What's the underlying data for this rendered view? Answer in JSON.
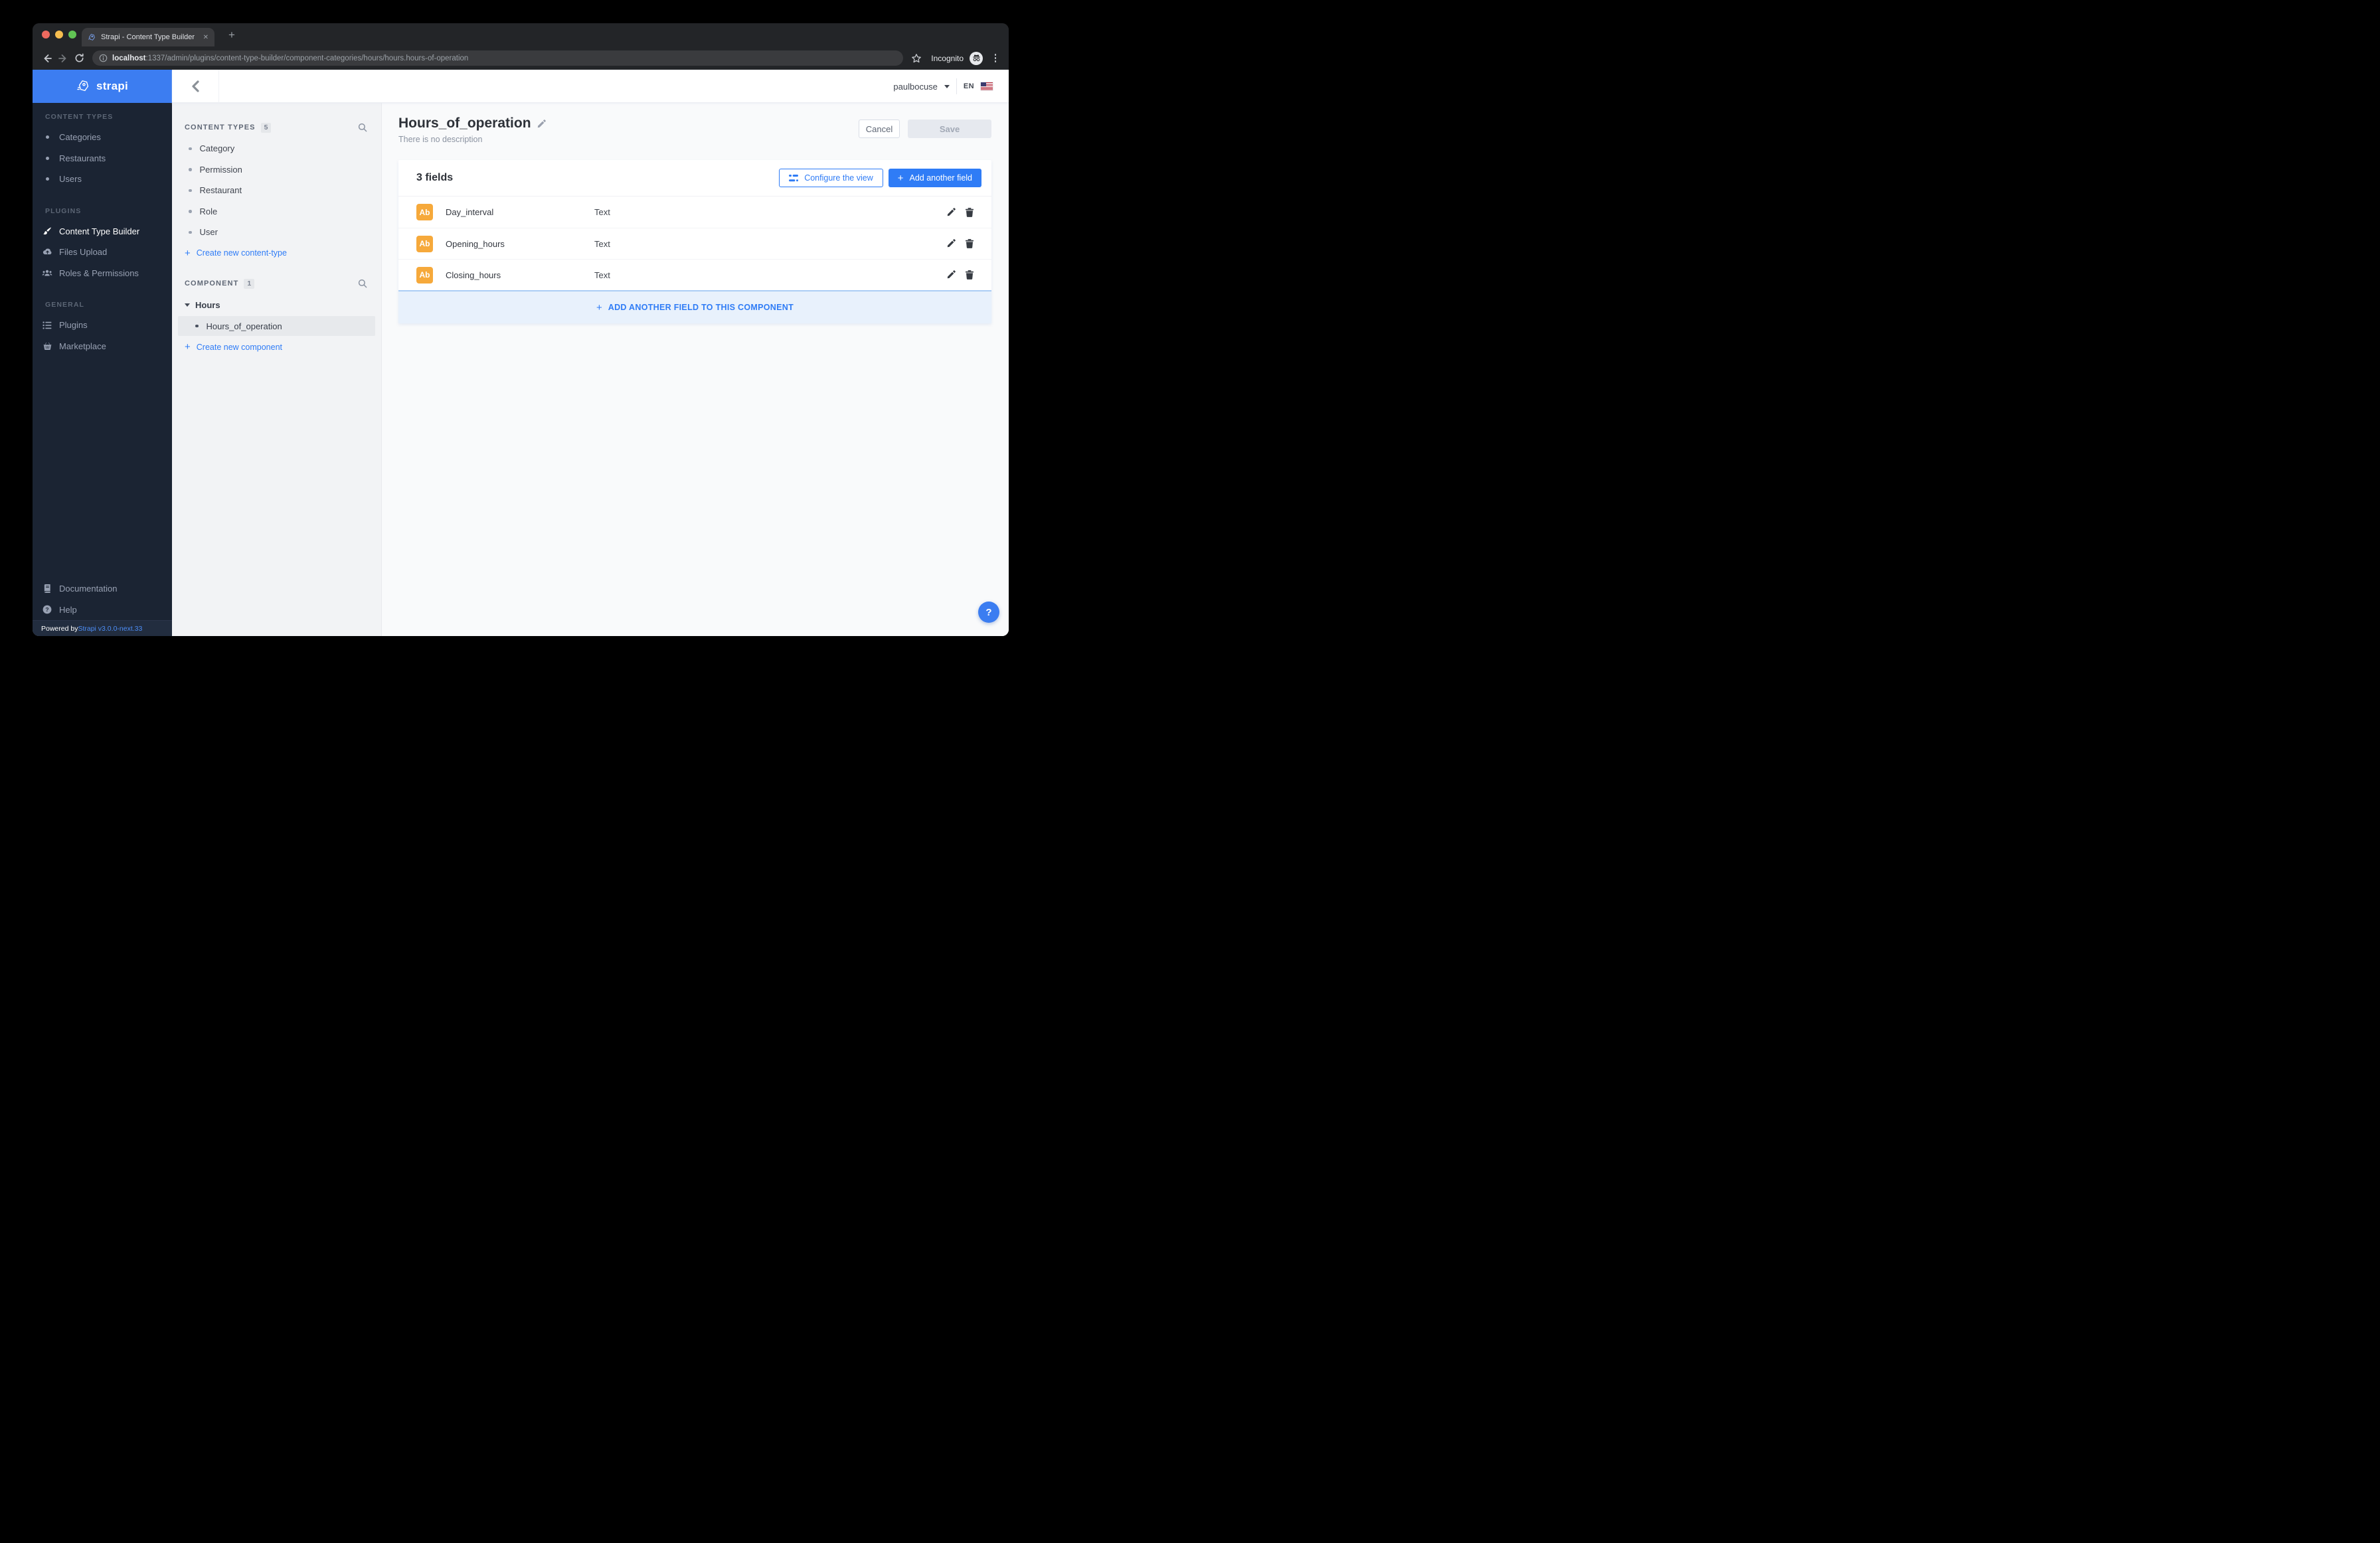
{
  "browser": {
    "tab_title": "Strapi - Content Type Builder",
    "close_tab": "✕",
    "new_tab": "+",
    "url_host": "localhost",
    "url_rest": ":1337/admin/plugins/content-type-builder/component-categories/hours/hours.hours-of-operation",
    "incognito_label": "Incognito"
  },
  "app_header": {
    "user": "paulbocuse",
    "locale": "EN"
  },
  "sidebar": {
    "brand": "strapi",
    "sections": [
      {
        "label": "CONTENT TYPES",
        "items": [
          {
            "label": "Categories"
          },
          {
            "label": "Restaurants"
          },
          {
            "label": "Users"
          }
        ]
      },
      {
        "label": "PLUGINS",
        "items": [
          {
            "label": "Content Type Builder"
          },
          {
            "label": "Files Upload"
          },
          {
            "label": "Roles & Permissions"
          }
        ]
      },
      {
        "label": "GENERAL",
        "items": [
          {
            "label": "Plugins"
          },
          {
            "label": "Marketplace"
          }
        ]
      }
    ],
    "bottom_items": [
      {
        "label": "Documentation"
      },
      {
        "label": "Help"
      }
    ],
    "footer_prefix": "Powered by ",
    "footer_link": "Strapi v3.0.0-next.33"
  },
  "subnav": {
    "content_types": {
      "label": "CONTENT TYPES",
      "count": "5",
      "items": [
        "Category",
        "Permission",
        "Restaurant",
        "Role",
        "User"
      ],
      "create": "Create new content-type"
    },
    "component": {
      "label": "COMPONENT",
      "count": "1",
      "group": "Hours",
      "selected_item": "Hours_of_operation",
      "create": "Create new component"
    }
  },
  "main": {
    "title": "Hours_of_operation",
    "description": "There is no description",
    "cancel_label": "Cancel",
    "save_label": "Save",
    "fields_count": "3 fields",
    "configure_label": "Configure the view",
    "add_field_label": "Add another field",
    "fields": [
      {
        "badge": "Ab",
        "name": "Day_interval",
        "type": "Text"
      },
      {
        "badge": "Ab",
        "name": "Opening_hours",
        "type": "Text"
      },
      {
        "badge": "Ab",
        "name": "Closing_hours",
        "type": "Text"
      }
    ],
    "add_row_label": "ADD ANOTHER FIELD TO THIS COMPONENT",
    "help_label": "?"
  },
  "colors": {
    "accent": "#2f7cf6",
    "logo_blue": "#3c7df1",
    "badge_orange": "#f6a93b",
    "sidebar_bg": "#1b2433",
    "addrow_bg": "#e8f1fc"
  }
}
